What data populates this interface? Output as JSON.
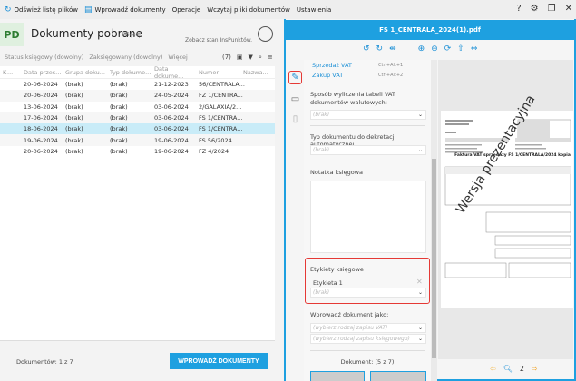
{
  "toolbar": {
    "refresh": "Odśwież listę plików",
    "enter": "Wprowadź dokumenty",
    "operations": "Operacje",
    "load": "Wczytaj pliki dokumentów",
    "settings": "Ustawienia"
  },
  "header": {
    "badge": "PD",
    "title": "Dokumenty pobrane",
    "more": "Więcej",
    "inspunkt": "Zobacz stan InsPunktów."
  },
  "filters": {
    "status": "Status księgowy (dowolny)",
    "posted": "Zaksięgowany (dowolny)",
    "more": "Więcej",
    "count": "(7)"
  },
  "table": {
    "headers": [
      "K",
      "...",
      "Data przes...",
      "Grupa doku...",
      "Typ dokume...",
      "Data dokume...",
      "Numer",
      "Nazwa..."
    ],
    "rows": [
      [
        "20-06-2024",
        "(brak)",
        "(brak)",
        "21-12-2023",
        "56/CENTRALA..."
      ],
      [
        "20-06-2024",
        "(brak)",
        "(brak)",
        "24-05-2024",
        "FZ 1/CENTRA..."
      ],
      [
        "13-06-2024",
        "(brak)",
        "(brak)",
        "03-06-2024",
        "2/GALAXIA/2..."
      ],
      [
        "17-06-2024",
        "(brak)",
        "(brak)",
        "03-06-2024",
        "FS 1/CENTRA..."
      ],
      [
        "18-06-2024",
        "(brak)",
        "(brak)",
        "03-06-2024",
        "FS 1/CENTRA..."
      ],
      [
        "19-06-2024",
        "(brak)",
        "(brak)",
        "19-06-2024",
        "FS 56/2024"
      ],
      [
        "20-06-2024",
        "(brak)",
        "(brak)",
        "19-06-2024",
        "FZ 4/2024"
      ]
    ],
    "selected_index": 4
  },
  "footer": {
    "count": "Dokumentów: 1 z 7",
    "enter_button": "WPROWADŹ DOKUMENTY"
  },
  "right": {
    "title": "FS 1_CENTRALA_2024(1).pdf",
    "menu": [
      {
        "label": "Sprzedaż VAT",
        "shortcut": "Ctrl+Alt+1"
      },
      {
        "label": "Zakup VAT",
        "shortcut": "Ctrl+Alt+2"
      }
    ],
    "vat_method_label": "Sposób wyliczenia tabeli VAT dokumentów walutowych:",
    "none": "(brak)",
    "decree_label": "Typ dokumentu do dekretacji automatycznej",
    "note_label": "Notatka księgowa",
    "tags_label": "Etykiety księgowe",
    "tag1": "Etykieta 1",
    "enter_as_label": "Wprowadź dokument jako:",
    "vat_placeholder": "(wybierz rodzaj zapisu VAT)",
    "acc_placeholder": "(wybierz rodzaj zapisu księgowego)",
    "doc_counter": "Dokument: (5 z 7)",
    "pdf_title": "Faktura VAT sprzedaży FS 1/CENTRALA/2024 kopia",
    "watermark": "Wersja prezentacyjna",
    "page": "2"
  },
  "colors": {
    "accent": "#1ea0e0",
    "selected": "#c9ecf8",
    "highlight": "#e53935"
  }
}
